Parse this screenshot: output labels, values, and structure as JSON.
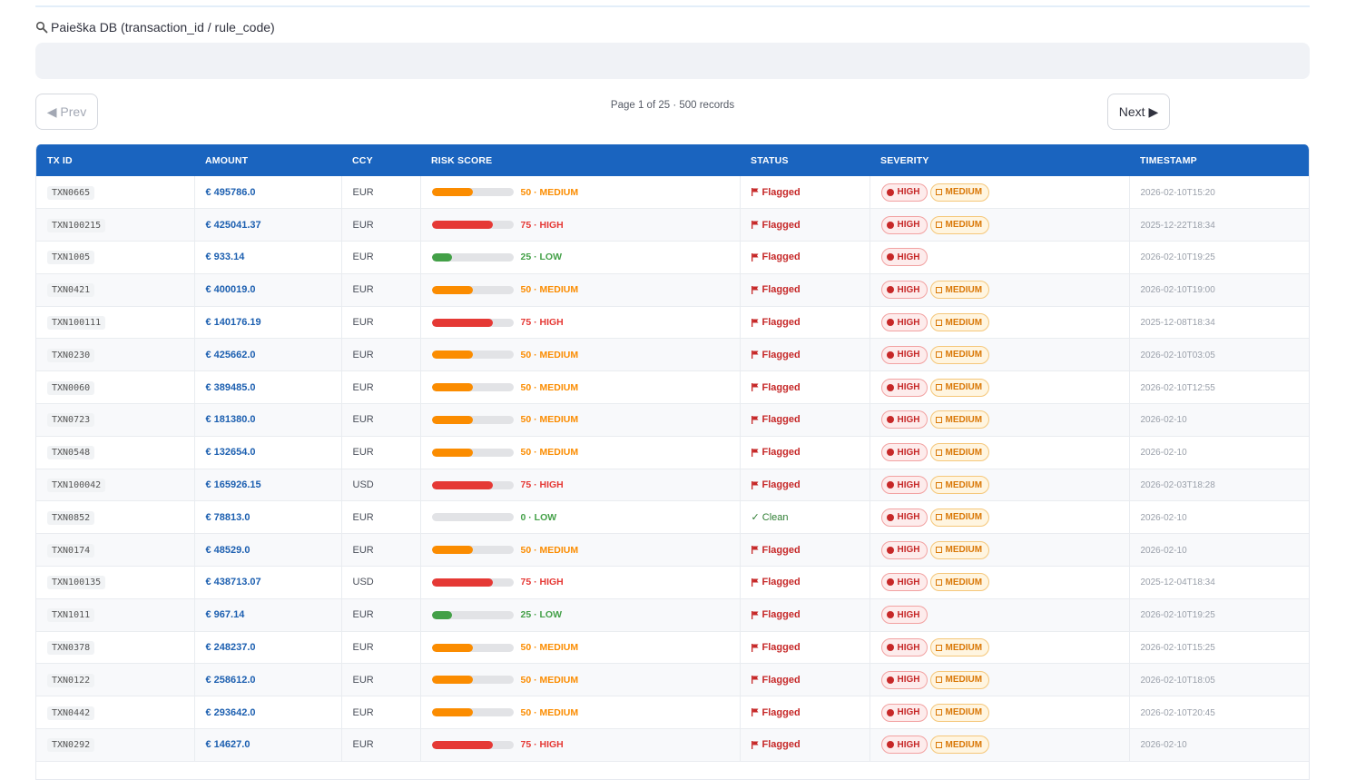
{
  "search": {
    "label": "Paieška DB (transaction_id / rule_code)",
    "value": "",
    "placeholder": ""
  },
  "pagination": {
    "prev_label": "◀ Prev",
    "next_label": "Next ▶",
    "info": "Page 1 of 25 · 500 records"
  },
  "table": {
    "headers": [
      "TX ID",
      "AMOUNT",
      "CCY",
      "RISK SCORE",
      "STATUS",
      "SEVERITY",
      "TIMESTAMP"
    ],
    "rows": [
      {
        "tx_id": "TXN0665",
        "amount": "€ 495786.0",
        "ccy": "EUR",
        "risk_value": 50,
        "risk_label": "50 · MEDIUM",
        "status": "Flagged",
        "severity": [
          "HIGH",
          "MEDIUM"
        ],
        "timestamp": "2026-02-10T15:20"
      },
      {
        "tx_id": "TXN100215",
        "amount": "€ 425041.37",
        "ccy": "EUR",
        "risk_value": 75,
        "risk_label": "75 · HIGH",
        "status": "Flagged",
        "severity": [
          "HIGH",
          "MEDIUM"
        ],
        "timestamp": "2025-12-22T18:34"
      },
      {
        "tx_id": "TXN1005",
        "amount": "€ 933.14",
        "ccy": "EUR",
        "risk_value": 25,
        "risk_label": "25 · LOW",
        "status": "Flagged",
        "severity": [
          "HIGH"
        ],
        "timestamp": "2026-02-10T19:25"
      },
      {
        "tx_id": "TXN0421",
        "amount": "€ 400019.0",
        "ccy": "EUR",
        "risk_value": 50,
        "risk_label": "50 · MEDIUM",
        "status": "Flagged",
        "severity": [
          "HIGH",
          "MEDIUM"
        ],
        "timestamp": "2026-02-10T19:00"
      },
      {
        "tx_id": "TXN100111",
        "amount": "€ 140176.19",
        "ccy": "EUR",
        "risk_value": 75,
        "risk_label": "75 · HIGH",
        "status": "Flagged",
        "severity": [
          "HIGH",
          "MEDIUM"
        ],
        "timestamp": "2025-12-08T18:34"
      },
      {
        "tx_id": "TXN0230",
        "amount": "€ 425662.0",
        "ccy": "EUR",
        "risk_value": 50,
        "risk_label": "50 · MEDIUM",
        "status": "Flagged",
        "severity": [
          "HIGH",
          "MEDIUM"
        ],
        "timestamp": "2026-02-10T03:05"
      },
      {
        "tx_id": "TXN0060",
        "amount": "€ 389485.0",
        "ccy": "EUR",
        "risk_value": 50,
        "risk_label": "50 · MEDIUM",
        "status": "Flagged",
        "severity": [
          "HIGH",
          "MEDIUM"
        ],
        "timestamp": "2026-02-10T12:55"
      },
      {
        "tx_id": "TXN0723",
        "amount": "€ 181380.0",
        "ccy": "EUR",
        "risk_value": 50,
        "risk_label": "50 · MEDIUM",
        "status": "Flagged",
        "severity": [
          "HIGH",
          "MEDIUM"
        ],
        "timestamp": "2026-02-10"
      },
      {
        "tx_id": "TXN0548",
        "amount": "€ 132654.0",
        "ccy": "EUR",
        "risk_value": 50,
        "risk_label": "50 · MEDIUM",
        "status": "Flagged",
        "severity": [
          "HIGH",
          "MEDIUM"
        ],
        "timestamp": "2026-02-10"
      },
      {
        "tx_id": "TXN100042",
        "amount": "€ 165926.15",
        "ccy": "USD",
        "risk_value": 75,
        "risk_label": "75 · HIGH",
        "status": "Flagged",
        "severity": [
          "HIGH",
          "MEDIUM"
        ],
        "timestamp": "2026-02-03T18:28"
      },
      {
        "tx_id": "TXN0852",
        "amount": "€ 78813.0",
        "ccy": "EUR",
        "risk_value": 0,
        "risk_label": "0 · LOW",
        "status": "✓ Clean",
        "severity": [
          "HIGH",
          "MEDIUM"
        ],
        "timestamp": "2026-02-10"
      },
      {
        "tx_id": "TXN0174",
        "amount": "€ 48529.0",
        "ccy": "EUR",
        "risk_value": 50,
        "risk_label": "50 · MEDIUM",
        "status": "Flagged",
        "severity": [
          "HIGH",
          "MEDIUM"
        ],
        "timestamp": "2026-02-10"
      },
      {
        "tx_id": "TXN100135",
        "amount": "€ 438713.07",
        "ccy": "USD",
        "risk_value": 75,
        "risk_label": "75 · HIGH",
        "status": "Flagged",
        "severity": [
          "HIGH",
          "MEDIUM"
        ],
        "timestamp": "2025-12-04T18:34"
      },
      {
        "tx_id": "TXN1011",
        "amount": "€ 967.14",
        "ccy": "EUR",
        "risk_value": 25,
        "risk_label": "25 · LOW",
        "status": "Flagged",
        "severity": [
          "HIGH"
        ],
        "timestamp": "2026-02-10T19:25"
      },
      {
        "tx_id": "TXN0378",
        "amount": "€ 248237.0",
        "ccy": "EUR",
        "risk_value": 50,
        "risk_label": "50 · MEDIUM",
        "status": "Flagged",
        "severity": [
          "HIGH",
          "MEDIUM"
        ],
        "timestamp": "2026-02-10T15:25"
      },
      {
        "tx_id": "TXN0122",
        "amount": "€ 258612.0",
        "ccy": "EUR",
        "risk_value": 50,
        "risk_label": "50 · MEDIUM",
        "status": "Flagged",
        "severity": [
          "HIGH",
          "MEDIUM"
        ],
        "timestamp": "2026-02-10T18:05"
      },
      {
        "tx_id": "TXN0442",
        "amount": "€ 293642.0",
        "ccy": "EUR",
        "risk_value": 50,
        "risk_label": "50 · MEDIUM",
        "status": "Flagged",
        "severity": [
          "HIGH",
          "MEDIUM"
        ],
        "timestamp": "2026-02-10T20:45"
      },
      {
        "tx_id": "TXN0292",
        "amount": "€ 14627.0",
        "ccy": "EUR",
        "risk_value": 75,
        "risk_label": "75 · HIGH",
        "status": "Flagged",
        "severity": [
          "HIGH",
          "MEDIUM"
        ],
        "timestamp": "2026-02-10"
      }
    ]
  },
  "colors": {
    "header_bg": "#1a64bf",
    "risk_high": "#e53935",
    "risk_medium": "#fb8c00",
    "risk_low": "#43a047",
    "flagged": "#c62828",
    "clean": "#2e7d32",
    "amount": "#1c5fb0"
  }
}
